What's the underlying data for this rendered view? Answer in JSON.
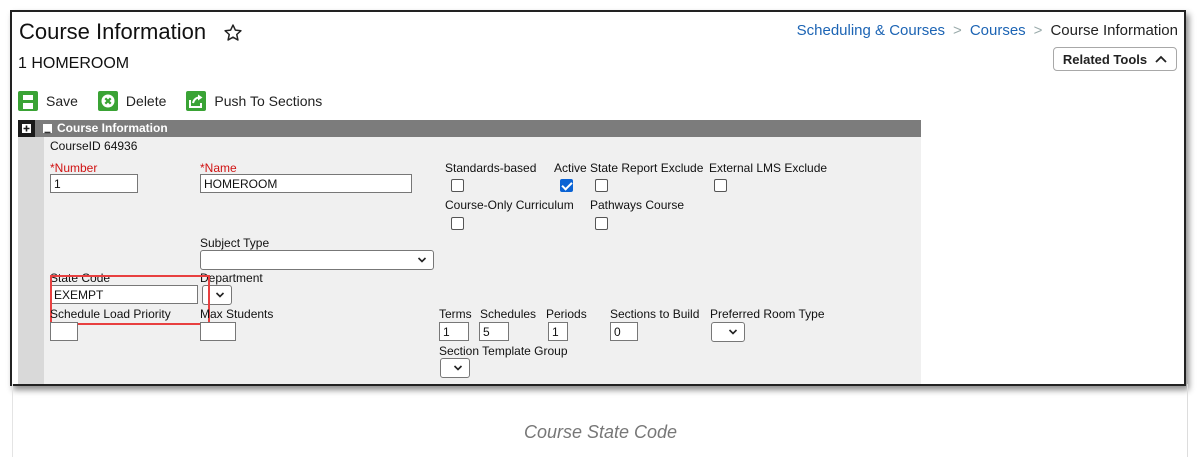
{
  "header": {
    "title": "Course Information",
    "course_name": "1 HOMEROOM",
    "related_tools_label": "Related Tools"
  },
  "breadcrumb": [
    "Scheduling & Courses",
    "Courses",
    "Course Information"
  ],
  "toolbar": {
    "save_label": "Save",
    "delete_label": "Delete",
    "push_label": "Push To Sections"
  },
  "panel": {
    "title": "Course Information",
    "course_id": "CourseID 64936"
  },
  "fields": {
    "number": {
      "label": "Number",
      "required": "*",
      "value": "1"
    },
    "name": {
      "label": "Name",
      "required": "*",
      "value": "HOMEROOM"
    },
    "subject_type": {
      "label": "Subject Type",
      "value": ""
    },
    "state_code": {
      "label": "State Code",
      "value": "EXEMPT"
    },
    "department": {
      "label": "Department",
      "value": ""
    },
    "schedule_load_priority": {
      "label": "Schedule Load Priority",
      "value": ""
    },
    "max_students": {
      "label": "Max Students",
      "value": ""
    },
    "terms": {
      "label": "Terms",
      "value": "1"
    },
    "schedules": {
      "label": "Schedules",
      "value": "5"
    },
    "periods": {
      "label": "Periods",
      "value": "1"
    },
    "sections_to_build": {
      "label": "Sections to Build",
      "value": "0"
    },
    "preferred_room_type": {
      "label": "Preferred Room Type",
      "value": ""
    },
    "section_template_group": {
      "label": "Section Template Group",
      "value": ""
    }
  },
  "checkboxes": {
    "standards_based": {
      "label": "Standards-based",
      "checked": false
    },
    "active": {
      "label": "Active",
      "checked": true
    },
    "state_report_exclude": {
      "label": "State Report Exclude",
      "checked": false
    },
    "external_lms_exclude": {
      "label": "External LMS Exclude",
      "checked": false
    },
    "course_only_curriculum": {
      "label": "Course-Only Curriculum",
      "checked": false
    },
    "pathways_course": {
      "label": "Pathways Course",
      "checked": false
    }
  },
  "caption": "Course State Code",
  "colors": {
    "link": "#1c64b4",
    "required": "#d01212",
    "highlight": "#e84040",
    "save_icon": "#3aa335",
    "delete_icon": "#3aa335",
    "checkbox_checked": "#0b63d4"
  },
  "icons": {
    "star": "star-outline-icon",
    "chevron_up": "chevron-up-icon",
    "save": "floppy-disk-icon",
    "delete": "x-circle-icon",
    "push": "share-arrow-icon",
    "expand": "plus-square-icon",
    "collapse": "minus-square-icon",
    "dropdown": "chevron-down-icon"
  }
}
